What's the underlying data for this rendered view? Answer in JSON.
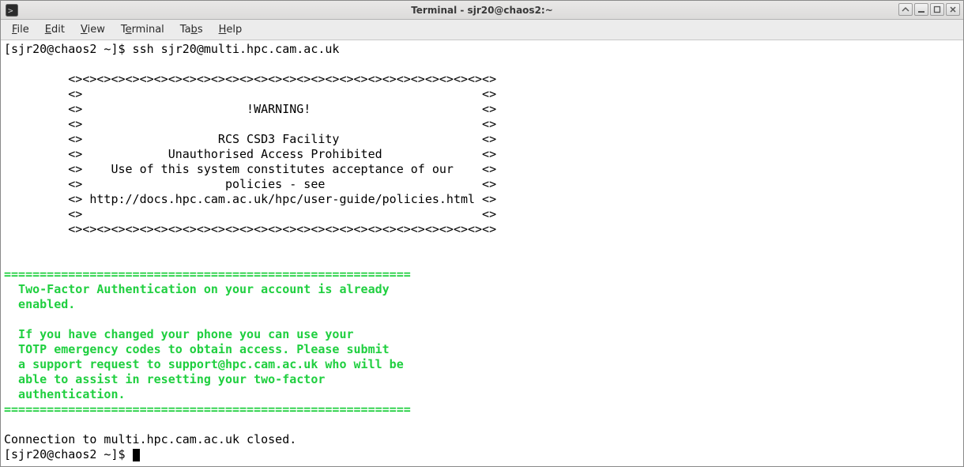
{
  "window": {
    "title": "Terminal - sjr20@chaos2:~"
  },
  "menubar": {
    "file": "File",
    "edit": "Edit",
    "view": "View",
    "terminal": "Terminal",
    "tabs": "Tabs",
    "help": "Help"
  },
  "term": {
    "line1": "[sjr20@chaos2 ~]$ ssh sjr20@multi.hpc.cam.ac.uk",
    "banner01": "         <><><><><><><><><><><><><><><><><><><><><><><><><><><><><><>",
    "banner02": "         <>                                                        <>",
    "banner03": "         <>                       !WARNING!                        <>",
    "banner04": "         <>                                                        <>",
    "banner05": "         <>                   RCS CSD3 Facility                    <>",
    "banner06": "         <>            Unauthorised Access Prohibited              <>",
    "banner07": "         <>    Use of this system constitutes acceptance of our    <>",
    "banner08": "         <>                    policies - see                      <>",
    "banner09": "         <> http://docs.hpc.cam.ac.uk/hpc/user-guide/policies.html <>",
    "banner10": "         <>                                                        <>",
    "banner11": "         <><><><><><><><><><><><><><><><><><><><><><><><><><><><><><>",
    "g_rule1": "=========================================================",
    "g_msg1": "  Two-Factor Authentication on your account is already",
    "g_msg2": "  enabled.",
    "g_msg3": "  If you have changed your phone you can use your",
    "g_msg4": "  TOTP emergency codes to obtain access. Please submit",
    "g_msg5": "  a support request to support@hpc.cam.ac.uk who will be",
    "g_msg6": "  able to assist in resetting your two-factor",
    "g_msg7": "  authentication.",
    "g_rule2": "=========================================================",
    "closed": "Connection to multi.hpc.cam.ac.uk closed.",
    "prompt": "[sjr20@chaos2 ~]$ "
  }
}
